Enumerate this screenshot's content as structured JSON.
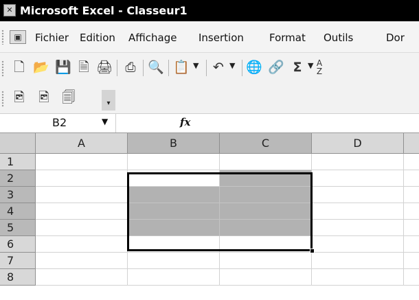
{
  "window": {
    "title": "Microsoft Excel - Classeur1",
    "app_icon": "excel-app-icon"
  },
  "menu": {
    "doc_icon": "document-control-icon",
    "items": [
      "Fichier",
      "Edition",
      "Affichage",
      "Insertion",
      "Format",
      "Outils",
      "Dor"
    ]
  },
  "toolbar_standard": {
    "icons": [
      "new-document-icon",
      "open-folder-icon",
      "save-icon",
      "permission-icon",
      "print-preview-icon",
      "print-icon",
      "research-icon",
      "paste-icon",
      "undo-icon",
      "insert-hyperlink-icon",
      "link-icon",
      "autosum-icon",
      "sort-icon"
    ],
    "autosum_symbol": "Σ"
  },
  "toolbar_extra": {
    "icons": [
      "pdf-convert-icon",
      "pdf-create-icon",
      "pdf-attach-icon"
    ]
  },
  "formula_bar": {
    "name_box": "B2",
    "fx_label": "fx",
    "formula": ""
  },
  "sheet": {
    "columns": [
      "A",
      "B",
      "C",
      "D"
    ],
    "rows": [
      "1",
      "2",
      "3",
      "4",
      "5",
      "6",
      "7",
      "8"
    ],
    "active_cell": "B2",
    "selection": "B2:C5",
    "colors": {
      "selection_fill": "#b2b2b2",
      "header_fill": "#d8d8d8",
      "header_active_fill": "#b9b9b9"
    }
  }
}
